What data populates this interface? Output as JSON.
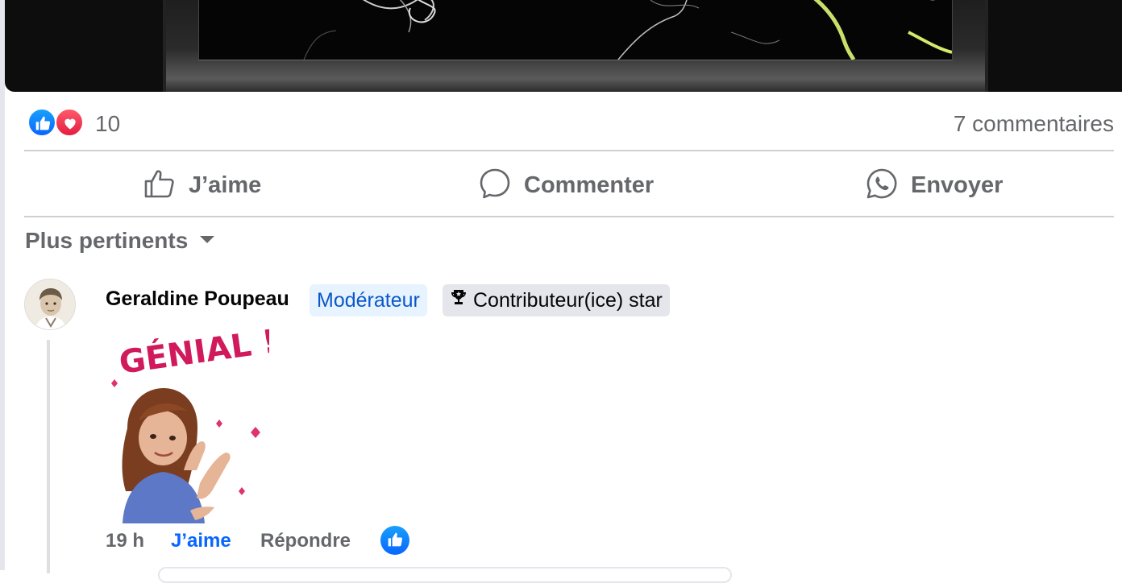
{
  "post": {
    "reaction_count": "10",
    "comments_count": "7 commentaires",
    "reaction_icons": [
      "like-icon",
      "heart-icon"
    ]
  },
  "actions": {
    "like": "J’aime",
    "comment": "Commenter",
    "send": "Envoyer"
  },
  "sort": {
    "label": "Plus pertinents"
  },
  "comment": {
    "author": "Geraldine Poupeau",
    "badge_moderator": "Modérateur",
    "badge_star": "Contributeur(ice) star",
    "sticker_text": "GÉNIAL !",
    "time": "19 h",
    "like": "J’aime",
    "reply": "Répondre"
  },
  "colors": {
    "accent": "#0866ff",
    "muted_text": "#65676b",
    "heart": "#e41e3f",
    "moderator_badge_bg": "#e7f3ff",
    "star_badge_bg": "#e4e6eb"
  }
}
